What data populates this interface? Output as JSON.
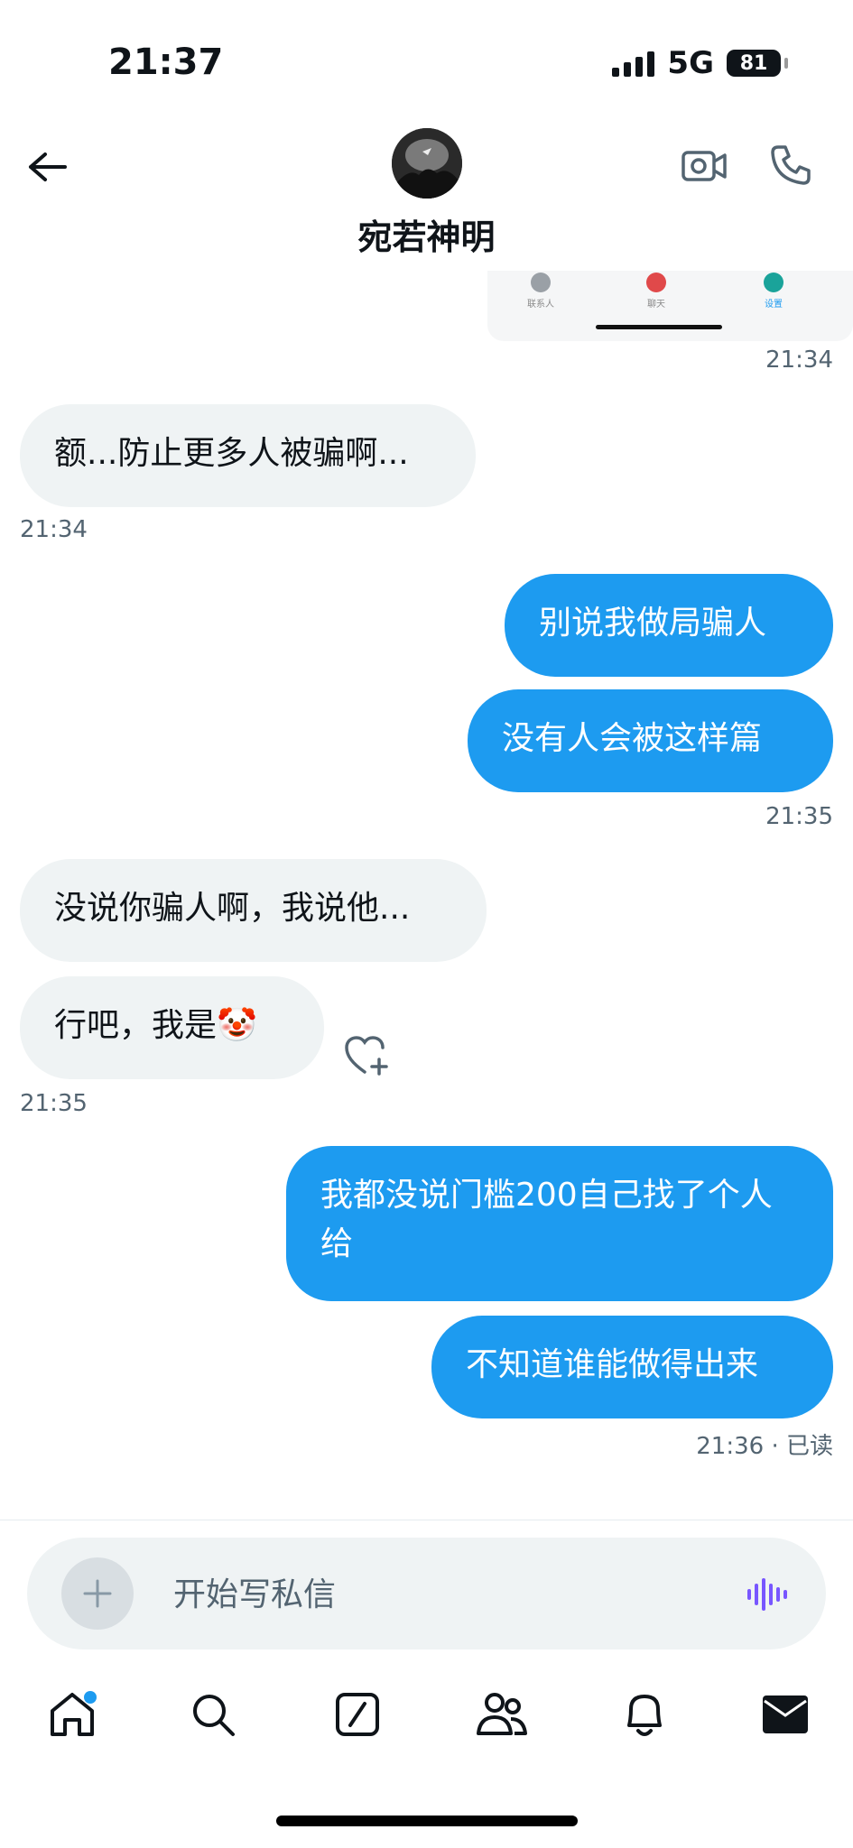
{
  "status_bar": {
    "time": "21:37",
    "network": "5G",
    "battery": "81"
  },
  "header": {
    "contact_name": "宛若神明"
  },
  "image_fragment": {
    "tabs": [
      "联系人",
      "聊天",
      "设置"
    ]
  },
  "messages": [
    {
      "id": "ts1",
      "type": "timestamp",
      "text": "21:34"
    },
    {
      "id": "m1",
      "direction": "in",
      "text": "额...防止更多人被骗啊..."
    },
    {
      "id": "ts2",
      "type": "timestamp",
      "text": "21:34"
    },
    {
      "id": "m2",
      "direction": "out",
      "text": "别说我做局骗人"
    },
    {
      "id": "m3",
      "direction": "out",
      "text": "没有人会被这样篇"
    },
    {
      "id": "ts3",
      "type": "timestamp",
      "text": "21:35"
    },
    {
      "id": "m4",
      "direction": "in",
      "text": "没说你骗人啊，我说他..."
    },
    {
      "id": "m5",
      "direction": "in",
      "text": "行吧，我是🤡"
    },
    {
      "id": "ts4",
      "type": "timestamp",
      "text": "21:35"
    },
    {
      "id": "m6",
      "direction": "out",
      "text": "我都没说门槛200自己找了个人给"
    },
    {
      "id": "m7",
      "direction": "out",
      "text": "不知道谁能做得出来"
    },
    {
      "id": "ts5",
      "type": "timestamp",
      "text": "21:36 · 已读"
    }
  ],
  "composer": {
    "placeholder": "开始写私信"
  },
  "nav": [
    "home-icon",
    "search-icon",
    "compose-icon",
    "communities-icon",
    "notifications-icon",
    "messages-icon"
  ],
  "colors": {
    "accent": "#1d9bf0",
    "incoming_bubble": "#eff3f4",
    "voice": "#7856ff"
  }
}
